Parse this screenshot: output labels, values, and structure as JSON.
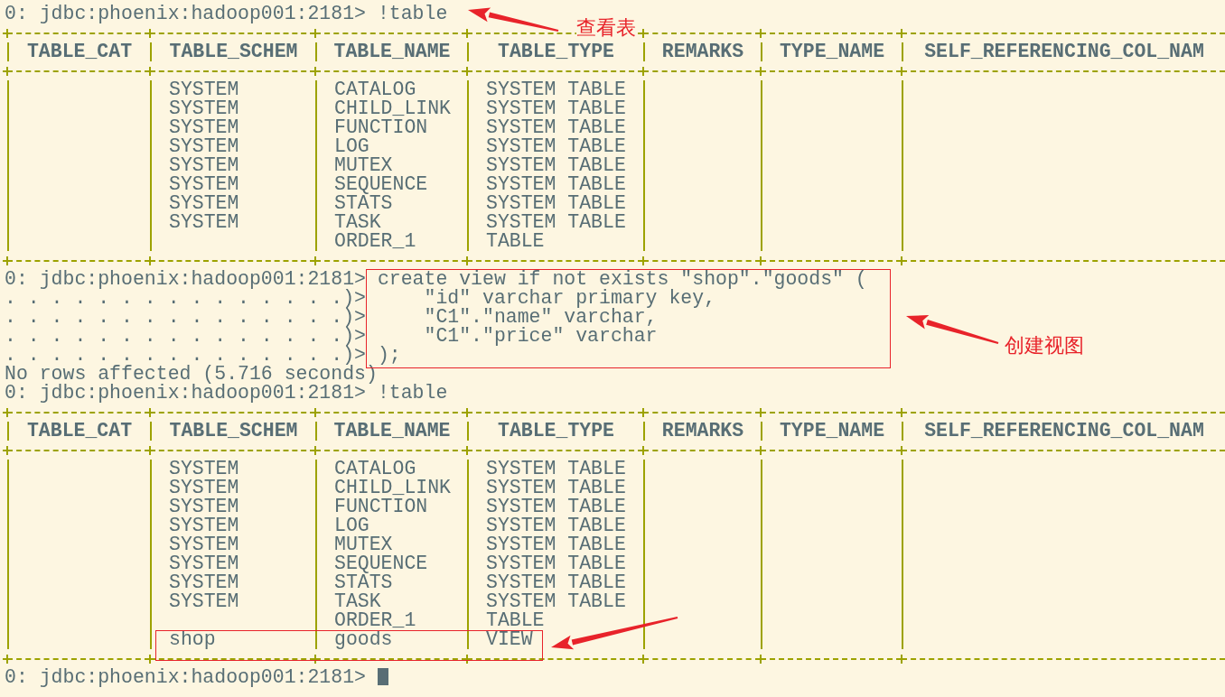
{
  "terminal": {
    "blocks": [
      {
        "kind": "prompt",
        "prompt": "0: jdbc:phoenix:hadoop001:2181>",
        "command": "!table"
      },
      {
        "kind": "table",
        "columns": [
          "TABLE_CAT",
          "TABLE_SCHEM",
          "TABLE_NAME",
          "TABLE_TYPE",
          "REMARKS",
          "TYPE_NAME",
          "SELF_REFERENCING_COL_NAM"
        ],
        "rows": [
          {
            "table_schem": "SYSTEM",
            "table_name": "CATALOG",
            "table_type": "SYSTEM TABLE"
          },
          {
            "table_schem": "SYSTEM",
            "table_name": "CHILD_LINK",
            "table_type": "SYSTEM TABLE"
          },
          {
            "table_schem": "SYSTEM",
            "table_name": "FUNCTION",
            "table_type": "SYSTEM TABLE"
          },
          {
            "table_schem": "SYSTEM",
            "table_name": "LOG",
            "table_type": "SYSTEM TABLE"
          },
          {
            "table_schem": "SYSTEM",
            "table_name": "MUTEX",
            "table_type": "SYSTEM TABLE"
          },
          {
            "table_schem": "SYSTEM",
            "table_name": "SEQUENCE",
            "table_type": "SYSTEM TABLE"
          },
          {
            "table_schem": "SYSTEM",
            "table_name": "STATS",
            "table_type": "SYSTEM TABLE"
          },
          {
            "table_schem": "SYSTEM",
            "table_name": "TASK",
            "table_type": "SYSTEM TABLE"
          },
          {
            "table_name": "ORDER_1",
            "table_type": "TABLE"
          }
        ]
      },
      {
        "kind": "prompt",
        "prompt": "0: jdbc:phoenix:hadoop001:2181>",
        "command": "create view if not exists \"shop\".\"goods\" ("
      },
      {
        "kind": "continuation",
        "prompt": ". . . . . . . . . . . . . . .)>",
        "command": "    \"id\" varchar primary key,"
      },
      {
        "kind": "continuation",
        "prompt": ". . . . . . . . . . . . . . .)>",
        "command": "    \"C1\".\"name\" varchar,"
      },
      {
        "kind": "continuation",
        "prompt": ". . . . . . . . . . . . . . .)>",
        "command": "    \"C1\".\"price\" varchar"
      },
      {
        "kind": "continuation",
        "prompt": ". . . . . . . . . . . . . . .)>",
        "command": ");"
      },
      {
        "kind": "output",
        "text": "No rows affected (5.716 seconds)"
      },
      {
        "kind": "prompt",
        "prompt": "0: jdbc:phoenix:hadoop001:2181>",
        "command": "!table"
      },
      {
        "kind": "table",
        "columns": [
          "TABLE_CAT",
          "TABLE_SCHEM",
          "TABLE_NAME",
          "TABLE_TYPE",
          "REMARKS",
          "TYPE_NAME",
          "SELF_REFERENCING_COL_NAM"
        ],
        "rows": [
          {
            "table_schem": "SYSTEM",
            "table_name": "CATALOG",
            "table_type": "SYSTEM TABLE"
          },
          {
            "table_schem": "SYSTEM",
            "table_name": "CHILD_LINK",
            "table_type": "SYSTEM TABLE"
          },
          {
            "table_schem": "SYSTEM",
            "table_name": "FUNCTION",
            "table_type": "SYSTEM TABLE"
          },
          {
            "table_schem": "SYSTEM",
            "table_name": "LOG",
            "table_type": "SYSTEM TABLE"
          },
          {
            "table_schem": "SYSTEM",
            "table_name": "MUTEX",
            "table_type": "SYSTEM TABLE"
          },
          {
            "table_schem": "SYSTEM",
            "table_name": "SEQUENCE",
            "table_type": "SYSTEM TABLE"
          },
          {
            "table_schem": "SYSTEM",
            "table_name": "STATS",
            "table_type": "SYSTEM TABLE"
          },
          {
            "table_schem": "SYSTEM",
            "table_name": "TASK",
            "table_type": "SYSTEM TABLE"
          },
          {
            "table_name": "ORDER_1",
            "table_type": "TABLE"
          },
          {
            "table_schem": "shop",
            "table_name": "goods",
            "table_type": "VIEW"
          }
        ]
      },
      {
        "kind": "prompt",
        "prompt": "0: jdbc:phoenix:hadoop001:2181>",
        "cursor": true
      }
    ]
  },
  "annotations": [
    {
      "kind": "arrow-label",
      "label": "查看表"
    },
    {
      "kind": "box-arrow-label",
      "label": "创建视图"
    },
    {
      "kind": "box-arrow"
    }
  ]
}
